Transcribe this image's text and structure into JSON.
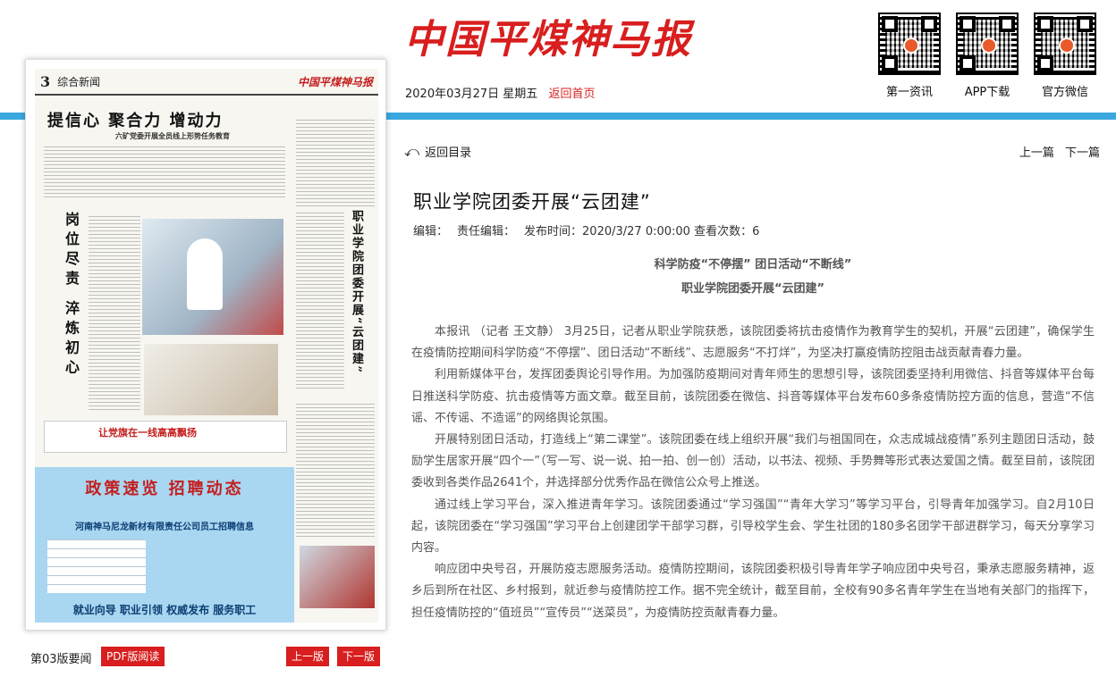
{
  "header": {
    "logo_text": "中国平煤神马报",
    "date": "2020年03月27日 星期五",
    "home_link": "返回首页",
    "qr_codes": [
      {
        "label": "第一资讯"
      },
      {
        "label": "APP下载"
      },
      {
        "label": "官方微信"
      }
    ]
  },
  "paper": {
    "page_no": "3",
    "section": "综合新闻",
    "masthead": "中国平煤神马报",
    "headline": "提信心 聚合力 增动力",
    "subheadline": "六矿党委开展全员线上形势任务教育",
    "vertical_title_1": "岗位尽责 淬炼初心",
    "vertical_title_2": "职业学院团委开展“云团建”",
    "banner": "让党旗在一线高高飘扬",
    "ad_title": "政策速览 招聘动态",
    "ad_company": "河南神马尼龙新材有限责任公司员工招聘信息",
    "ad_slogan": "就业向导 职业引领 权威发布 服务职工",
    "footer_label": "第03版要闻",
    "pdf_button": "PDF版阅读",
    "prev_page": "上一版",
    "next_page": "下一版"
  },
  "article": {
    "back_label": "返回目录",
    "prev_article": "上一篇",
    "next_article": "下一篇",
    "title": "职业学院团委开展“云团建”",
    "meta": {
      "editor": "编辑：",
      "duty_editor": "责任编辑：",
      "publish_time": "发布时间：2020/3/27 0:00:00",
      "views": "查看次数：6"
    },
    "subhead_1": "科学防疫“不停摆” 团日活动“不断线”",
    "subhead_2": "职业学院团委开展“云团建”",
    "paragraphs": [
      "本报讯 （记者 王文静） 3月25日，记者从职业学院获悉，该院团委将抗击疫情作为教育学生的契机，开展“云团建”，确保学生在疫情防控期间科学防疫“不停摆”、团日活动“不断线”、志愿服务“不打烊”，为坚决打赢疫情防控阻击战贡献青春力量。",
      "利用新媒体平台，发挥团委舆论引导作用。为加强防疫期间对青年师生的思想引导，该院团委坚持利用微信、抖音等媒体平台每日推送科学防疫、抗击疫情等方面文章。截至目前，该院团委在微信、抖音等媒体平台发布60多条疫情防控方面的信息，营造“不信谣、不传谣、不造谣”的网络舆论氛围。",
      "开展特别团日活动，打造线上“第二课堂”。该院团委在线上组织开展“我们与祖国同在，众志成城战疫情”系列主题团日活动，鼓励学生居家开展“四个一”（写一写、说一说、拍一拍、创一创）活动，以书法、视频、手势舞等形式表达爱国之情。截至目前，该院团委收到各类作品2641个，并选择部分优秀作品在微信公众号上推送。",
      "通过线上学习平台，深入推进青年学习。该院团委通过“学习强国”“青年大学习”等学习平台，引导青年加强学习。自2月10日起，该院团委在“学习强国”学习平台上创建团学干部学习群，引导校学生会、学生社团的180多名团学干部进群学习，每天分享学习内容。",
      "响应团中央号召，开展防疫志愿服务活动。疫情防控期间，该院团委积极引导青年学子响应团中央号召，秉承志愿服务精神，返乡后到所在社区、乡村报到，就近参与疫情防控工作。据不完全统计，截至目前，全校有90多名青年学生在当地有关部门的指挥下，担任疫情防控的“值班员”“宣传员”“送菜员”，为疫情防控贡献青春力量。"
    ]
  },
  "colors": {
    "brand_red": "#d81e1e",
    "accent_blue": "#3aa8df"
  }
}
